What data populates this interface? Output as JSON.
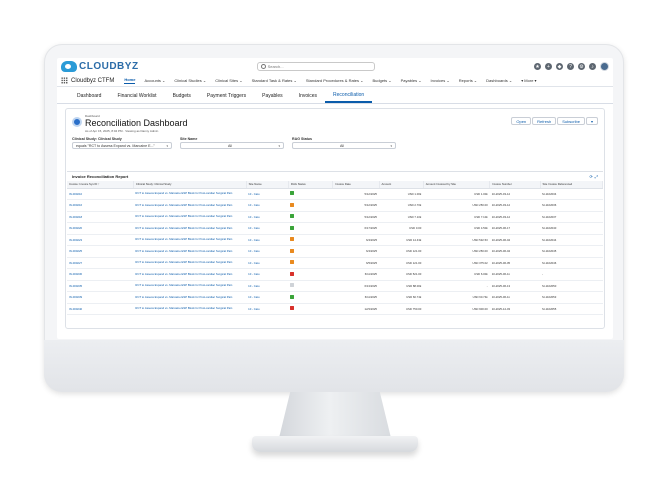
{
  "app": {
    "logo_text": "CLOUDBYZ",
    "app_name": "Cloudbyz CTFM",
    "search_placeholder": "Search..."
  },
  "nav": {
    "items": [
      {
        "label": "Home",
        "active": true
      },
      {
        "label": "Accounts ⌄",
        "active": false
      },
      {
        "label": "Clinical Studies ⌄",
        "active": false
      },
      {
        "label": "Clinical Sites ⌄",
        "active": false
      },
      {
        "label": "Standard Task & Rates ⌄",
        "active": false
      },
      {
        "label": "Standard Procedures & Rates ⌄",
        "active": false
      },
      {
        "label": "Budgets ⌄",
        "active": false
      },
      {
        "label": "Payables ⌄",
        "active": false
      },
      {
        "label": "Invoices ⌄",
        "active": false
      },
      {
        "label": "Reports ⌄",
        "active": false
      },
      {
        "label": "Dashboards ⌄",
        "active": false
      },
      {
        "label": "▾ More ▾",
        "active": false
      }
    ]
  },
  "tabs": [
    {
      "label": "Dashboard",
      "active": false
    },
    {
      "label": "Financial Worklist",
      "active": false
    },
    {
      "label": "Budgets",
      "active": false
    },
    {
      "label": "Payment Triggers",
      "active": false
    },
    {
      "label": "Payables",
      "active": false
    },
    {
      "label": "Invoices",
      "active": false
    },
    {
      "label": "Reconciliation",
      "active": true
    }
  ],
  "dashboard": {
    "type_label": "Dashboard",
    "title": "Reconciliation Dashboard",
    "subtitle": "As of Apr 15, 2025, 8:04 PM · Viewing as Danny Admin",
    "buttons": {
      "open": "Open",
      "refresh": "Refresh",
      "subscribe": "Subscribe",
      "more": "▾"
    },
    "filters": [
      {
        "label": "Clinical Study: Clinical Study",
        "value": "equals \"RCT to Assess Expand vs. Marcaine E...\""
      },
      {
        "label": "Site Name",
        "value": "All"
      },
      {
        "label": "RAG Status",
        "value": "All"
      }
    ]
  },
  "report": {
    "title": "Invoice Reconciliation Report",
    "columns": [
      "Invoice: Invoice Sys ID ↑",
      "Clinical Study: Clinical Study",
      "Site Name",
      "RAG Status",
      "Invoice Date",
      "Amount",
      "Amount Invoiced by Site",
      "Invoice Number",
      "Site Invoice Referenced"
    ],
    "rows": [
      {
        "id": "IN-000210",
        "study": "RCT to Assess Expand vs. Marcaine ESP Block for Post-cardiac Surgical Pain",
        "site": "10 - Cato",
        "rag": "#3aa43a",
        "date": "5/12/2025",
        "amount": "USD 1.00k",
        "invoiced": "USD 1.00k",
        "number": "10-2025-03-12",
        "ref": "SI-1102034"
      },
      {
        "id": "IN-000216",
        "study": "RCT to Assess Expand vs. Marcaine ESP Block for Post-cardiac Surgical Pain",
        "site": "10 - Cato",
        "rag": "#e98a1f",
        "date": "5/12/2025",
        "amount": "USD 2.70k",
        "invoiced": "USD 250.00",
        "number": "10-2025-03-12",
        "ref": "SI-1102036"
      },
      {
        "id": "IN-000218",
        "study": "RCT to Assess Expand vs. Marcaine ESP Block for Post-cardiac Surgical Pain",
        "site": "10 - Cato",
        "rag": "#3aa43a",
        "date": "5/12/2025",
        "amount": "USD 7.10k",
        "invoiced": "USD 7.10k",
        "number": "10-2025-03-12",
        "ref": "SI-1102037"
      },
      {
        "id": "IN-000220",
        "study": "RCT to Assess Expand vs. Marcaine ESP Block for Post-cardiac Surgical Pain",
        "site": "10 - Cato",
        "rag": "#3aa43a",
        "date": "6/17/2025",
        "amount": "USD 0.00",
        "invoiced": "USD 4.50k",
        "number": "10-2025-06-17",
        "ref": "SI-1102040"
      },
      {
        "id": "IN-000223",
        "study": "RCT to Assess Expand vs. Marcaine ESP Block for Post-cardiac Surgical Pain",
        "site": "10 - Cato",
        "rag": "#e98a1f",
        "date": "6/4/2025",
        "amount": "USD 14.43k",
        "invoiced": "USD 532.53",
        "number": "10-2025-06-04",
        "ref": "SI-1102044"
      },
      {
        "id": "IN-000225",
        "study": "RCT to Assess Expand vs. Marcaine ESP Block for Post-cardiac Surgical Pain",
        "site": "10 - Cato",
        "rag": "#e98a1f",
        "date": "6/4/2025",
        "amount": "USD 121.00",
        "invoiced": "USD 250.00",
        "number": "10-2025-06-04",
        "ref": "SI-1102045"
      },
      {
        "id": "IN-000227",
        "study": "RCT to Assess Expand vs. Marcaine ESP Block for Post-cardiac Surgical Pain",
        "site": "10 - Cato",
        "rag": "#e98a1f",
        "date": "6/5/2025",
        "amount": "USD 121.00",
        "invoiced": "USD 375.02",
        "number": "10-2025-06-05",
        "ref": "SI-1102046"
      },
      {
        "id": "IN-000230",
        "study": "RCT to Assess Expand vs. Marcaine ESP Block for Post-cardiac Surgical Pain",
        "site": "10 - Cato",
        "rag": "#d8312b",
        "date": "6/11/2025",
        "amount": "USD 521.00",
        "invoiced": "USD 6.00k",
        "number": "10-2025-06-11",
        "ref": "-"
      },
      {
        "id": "IN-000235",
        "study": "RCT to Assess Expand vs. Marcaine ESP Block for Post-cardiac Surgical Pain",
        "site": "10 - Cato",
        "rag": "#cfd3d8",
        "date": "6/13/2025",
        "amount": "USD 88.00k",
        "invoiced": "-",
        "number": "10-2025-06-13",
        "ref": "SI-1102050"
      },
      {
        "id": "IN-000239",
        "study": "RCT to Assess Expand vs. Marcaine ESP Block for Post-cardiac Surgical Pain",
        "site": "10 - Cato",
        "rag": "#3aa43a",
        "date": "6/11/2025",
        "amount": "USD 60.74k",
        "invoiced": "USD 60.74k",
        "number": "10-2025-06-11",
        "ref": "SI-1102053"
      },
      {
        "id": "IN-000240",
        "study": "RCT to Assess Expand vs. Marcaine ESP Block for Post-cardiac Surgical Pain",
        "site": "10 - Cato",
        "rag": "#d8312b",
        "date": "12/3/2025",
        "amount": "USD 750.00",
        "invoiced": "USD 900.00",
        "number": "10-2025-12-03",
        "ref": "SI-1102055"
      }
    ]
  }
}
